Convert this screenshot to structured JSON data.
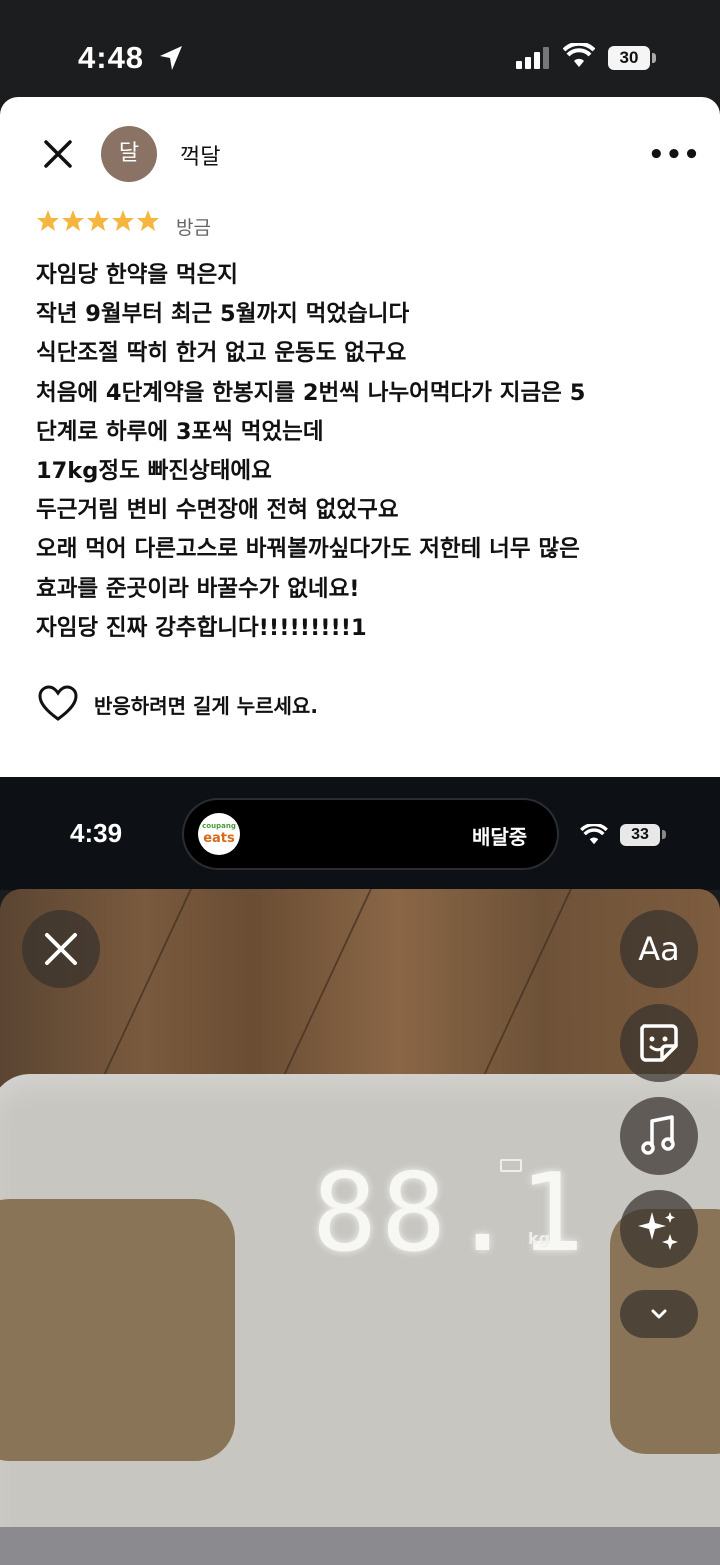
{
  "status_top": {
    "time": "4:48",
    "battery": "30"
  },
  "review": {
    "avatar_text": "달",
    "username": "꺽달",
    "rating": 5,
    "time_ago": "방금",
    "lines": [
      "자임당 한약을 먹은지",
      "작년 9월부터 최근 5월까지 먹었습니다",
      "식단조절 딱히 한거 없고 운동도 없구요",
      "처음에 4단계약을 한봉지를 2번씩 나누어먹다가 지금은 5",
      "단계로 하루에 3포씩 먹었는데",
      "17kg정도 빠진상태에요",
      "두근거림 변비 수면장애 전혀 없었구요",
      "오래 먹어 다른고스로 바꿔볼까싶다가도 저한테 너무 많은",
      "효과를 준곳이라 바꿀수가 없네요!",
      "자임당 진짜 강추합니다!!!!!!!!!1"
    ],
    "react_hint": "반응하려면 길게 누르세요."
  },
  "status_mid": {
    "time": "4:39",
    "app_logo_small": "coupang",
    "app_logo": "eats",
    "activity": "배달중",
    "battery": "33"
  },
  "photo": {
    "scale_reading": "88.1",
    "unit": "kg",
    "text_tool": "Aa"
  },
  "icons": [
    "close-icon",
    "more-icon",
    "star-icon",
    "heart-icon",
    "location-arrow-icon",
    "signal-icon",
    "wifi-icon",
    "sticker-icon",
    "music-icon",
    "sparkles-icon",
    "chevron-down-icon"
  ],
  "colors": {
    "star": "#f4b63f",
    "avatar": "#8a7264"
  }
}
